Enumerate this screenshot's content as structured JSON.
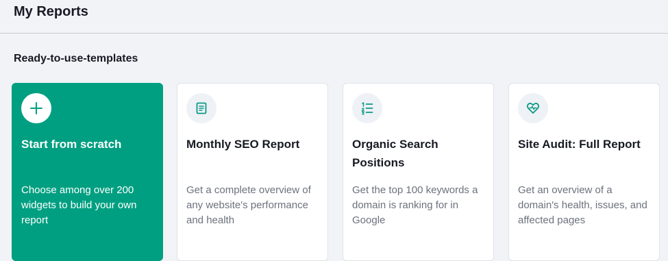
{
  "header": {
    "title": "My Reports"
  },
  "section": {
    "title": "Ready-to-use-templates"
  },
  "colors": {
    "accent": "#009f81",
    "icon_teal": "#0a9b86",
    "page_bg": "#f1f3f7"
  },
  "cards": [
    {
      "icon": "plus-icon",
      "title": "Start from scratch",
      "description": "Choose among over 200 widgets to build your own report"
    },
    {
      "icon": "document-icon",
      "title": "Monthly SEO Report",
      "description": "Get a complete overview of any website's performance and health"
    },
    {
      "icon": "numbered-list-icon",
      "title": "Organic Search Positions",
      "description": "Get the top 100 keywords a domain is ranking for in Google"
    },
    {
      "icon": "heart-pulse-icon",
      "title": "Site Audit: Full Report",
      "description": "Get an overview of a domain's health, issues, and affected pages"
    }
  ]
}
